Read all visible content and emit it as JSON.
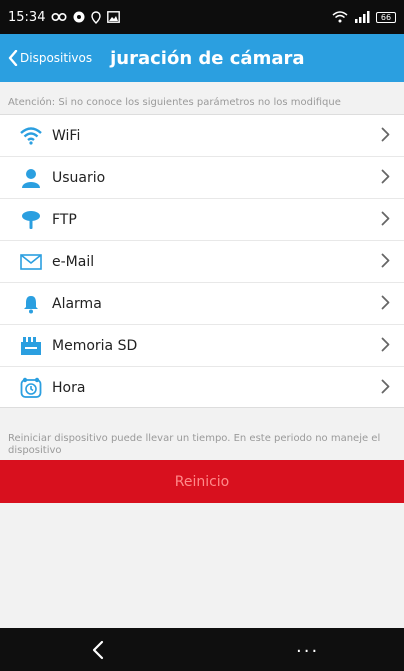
{
  "status_bar": {
    "time": "15:34",
    "battery": "66"
  },
  "header": {
    "back_label": "Dispositivos",
    "title": "juración de cámara"
  },
  "notice": "Atención: Si no conoce los siguientes parámetros no los modifique",
  "menu": {
    "items": [
      {
        "label": "WiFi",
        "icon": "wifi-icon"
      },
      {
        "label": "Usuario",
        "icon": "user-icon"
      },
      {
        "label": "FTP",
        "icon": "ftp-icon"
      },
      {
        "label": "e-Mail",
        "icon": "mail-icon"
      },
      {
        "label": "Alarma",
        "icon": "bell-icon"
      },
      {
        "label": "Memoria SD",
        "icon": "sd-card-icon"
      },
      {
        "label": "Hora",
        "icon": "clock-icon"
      }
    ]
  },
  "reset": {
    "notice": "Reiniciar dispositivo puede llevar un tiempo. En este periodo no maneje el dispositivo",
    "button_label": "Reinicio"
  },
  "nav_bar": {
    "more_label": "···"
  },
  "colors": {
    "accent": "#2b9fe0",
    "danger": "#d8101e",
    "status_bar": "#0d0d0d"
  }
}
